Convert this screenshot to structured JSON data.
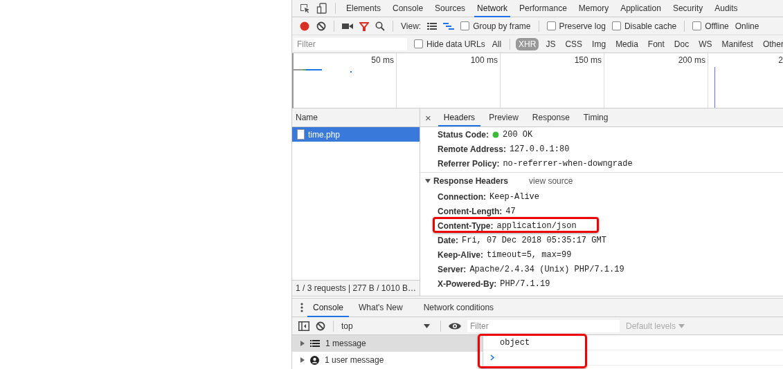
{
  "main_tabs": [
    {
      "label": "Elements",
      "selected": false
    },
    {
      "label": "Console",
      "selected": false
    },
    {
      "label": "Sources",
      "selected": false
    },
    {
      "label": "Network",
      "selected": true
    },
    {
      "label": "Performance",
      "selected": false
    },
    {
      "label": "Memory",
      "selected": false
    },
    {
      "label": "Application",
      "selected": false
    },
    {
      "label": "Security",
      "selected": false
    },
    {
      "label": "Audits",
      "selected": false
    }
  ],
  "toolbar": {
    "recording": true,
    "view_label": "View:",
    "checkboxes": [
      {
        "label": "Group by frame",
        "checked": false
      },
      {
        "label": "Preserve log",
        "checked": false
      },
      {
        "label": "Disable cache",
        "checked": false
      },
      {
        "label": "Offline",
        "checked": false
      }
    ],
    "throttling": "Online"
  },
  "filter_bar": {
    "placeholder": "Filter",
    "hide_data_urls": {
      "label": "Hide data URLs",
      "checked": false
    },
    "types": [
      {
        "label": "All",
        "selected": false
      },
      {
        "label": "XHR",
        "selected": true
      },
      {
        "label": "JS",
        "selected": false
      },
      {
        "label": "CSS",
        "selected": false
      },
      {
        "label": "Img",
        "selected": false
      },
      {
        "label": "Media",
        "selected": false
      },
      {
        "label": "Font",
        "selected": false
      },
      {
        "label": "Doc",
        "selected": false
      },
      {
        "label": "WS",
        "selected": false
      },
      {
        "label": "Manifest",
        "selected": false
      },
      {
        "label": "Other",
        "selected": false
      }
    ]
  },
  "overview": {
    "ticks": [
      "50 ms",
      "100 ms",
      "150 ms",
      "200 ms",
      "2"
    ]
  },
  "requests": {
    "column": "Name",
    "rows": [
      {
        "name": "time.php",
        "selected": true
      }
    ],
    "summary": "1 / 3 requests | 277 B / 1010 B…"
  },
  "detail": {
    "close": "×",
    "tabs": [
      {
        "label": "Headers",
        "selected": true
      },
      {
        "label": "Preview",
        "selected": false
      },
      {
        "label": "Response",
        "selected": false
      },
      {
        "label": "Timing",
        "selected": false
      }
    ],
    "general": [
      {
        "name": "Status Code:",
        "value": "200 OK",
        "kind": "status"
      },
      {
        "name": "Remote Address:",
        "value": "127.0.0.1:80",
        "kind": "plain"
      },
      {
        "name": "Referrer Policy:",
        "value": "no-referrer-when-downgrade",
        "kind": "plain"
      }
    ],
    "response_headers": {
      "title": "Response Headers",
      "expanded": true,
      "view_source": "view source",
      "rows": [
        {
          "name": "Connection:",
          "value": "Keep-Alive",
          "highlighted": false
        },
        {
          "name": "Content-Length:",
          "value": "47",
          "highlighted": false
        },
        {
          "name": "Content-Type:",
          "value": "application/json",
          "highlighted": true
        },
        {
          "name": "Date:",
          "value": "Fri, 07 Dec 2018 05:35:17 GMT",
          "highlighted": false
        },
        {
          "name": "Keep-Alive:",
          "value": "timeout=5, max=99",
          "highlighted": false
        },
        {
          "name": "Server:",
          "value": "Apache/2.4.34 (Unix) PHP/7.1.19",
          "highlighted": false
        },
        {
          "name": "X-Powered-By:",
          "value": "PHP/7.1.19",
          "highlighted": false
        }
      ]
    }
  },
  "drawer": {
    "tabs": [
      {
        "label": "Console",
        "selected": true
      },
      {
        "label": "What's New",
        "selected": false
      },
      {
        "label": "Network conditions",
        "selected": false
      }
    ],
    "context": "top",
    "filter_placeholder": "Filter",
    "levels": "Default levels",
    "sidebar": [
      {
        "label": "1 message",
        "kind": "all",
        "selected": true
      },
      {
        "label": "1 user message",
        "kind": "user",
        "selected": false
      }
    ],
    "output_highlighted": true,
    "output": [
      {
        "kind": "log",
        "text": "object"
      },
      {
        "kind": "prompt"
      }
    ]
  }
}
